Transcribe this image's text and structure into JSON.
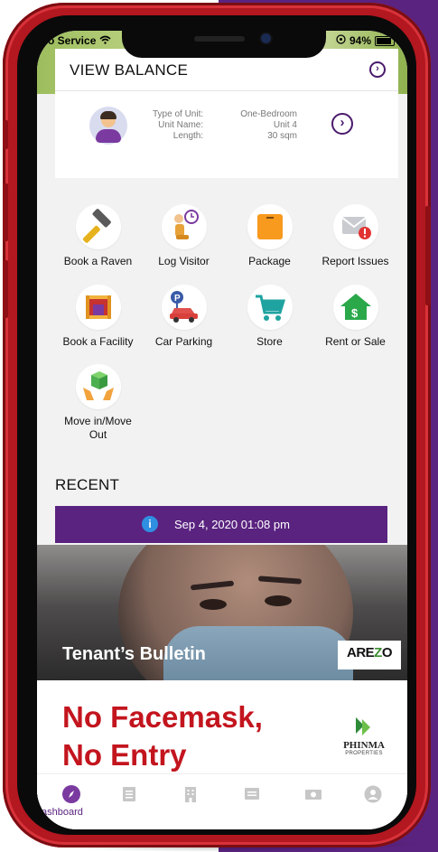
{
  "status_bar": {
    "carrier": "o Service",
    "battery": "94%"
  },
  "view_balance": {
    "title": "VIEW BALANCE",
    "labels": [
      "Type of Unit:",
      "Unit Name:",
      "Length:"
    ],
    "values": [
      "One-Bedroom",
      "Unit 4",
      "30 sqm"
    ]
  },
  "services": [
    {
      "label": "Book a Raven",
      "icon": "hammer-icon"
    },
    {
      "label": "Log Visitor",
      "icon": "visitor-clock-icon"
    },
    {
      "label": "Package",
      "icon": "package-icon"
    },
    {
      "label": "Report Issues",
      "icon": "mail-alert-icon"
    },
    {
      "label": "Book a Facility",
      "icon": "facility-icon"
    },
    {
      "label": "Car Parking",
      "icon": "car-parking-icon"
    },
    {
      "label": "Store",
      "icon": "cart-icon"
    },
    {
      "label": "Rent or Sale",
      "icon": "house-dollar-icon"
    },
    {
      "label": "Move in/Move Out",
      "icon": "move-box-icon"
    }
  ],
  "recent": {
    "title": "RECENT",
    "date": "Sep 4, 2020 01:08 pm",
    "bulletin_title": "Tenant’s Bulletin",
    "brand_logo": "AREZZO",
    "notice_line1": "No Facemask,",
    "notice_line2": "No Entry",
    "developer": "PHINMA",
    "developer_sub": "PROPERTIES"
  },
  "tabbar": {
    "active_label": "ashboard",
    "items": [
      "compass-icon",
      "list-icon",
      "building-icon",
      "message-icon",
      "cash-icon",
      "profile-icon"
    ]
  },
  "colors": {
    "brand_purple": "#5a2380",
    "phone_red": "#b3171f",
    "notice_red": "#c3151e"
  }
}
